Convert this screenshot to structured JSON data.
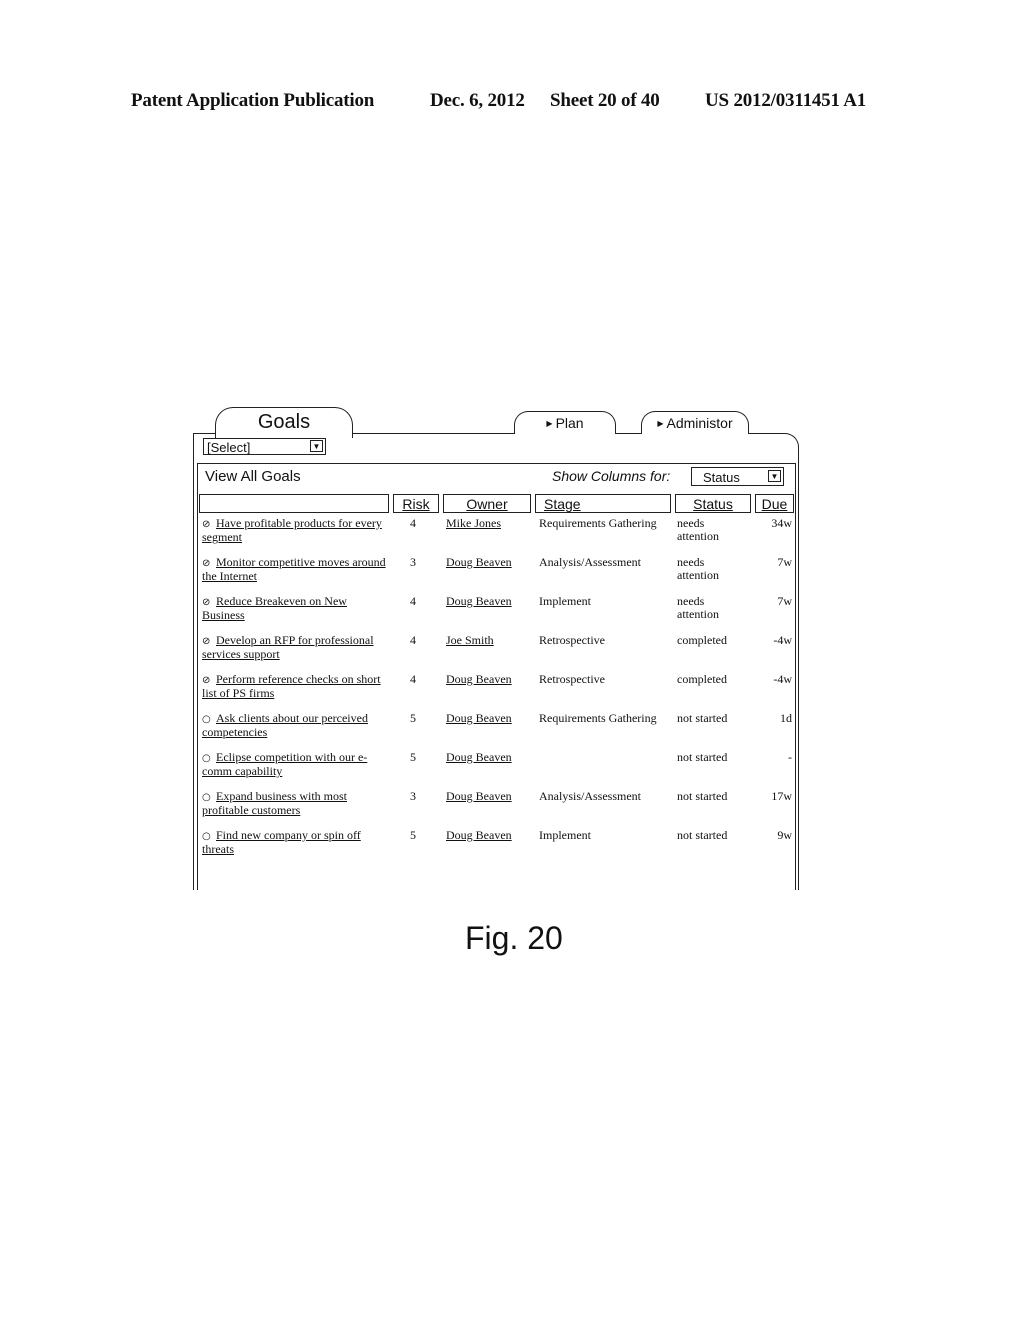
{
  "header": {
    "publication": "Patent Application Publication",
    "date": "Dec. 6, 2012",
    "sheet": "Sheet 20 of 40",
    "number": "US 2012/0311451 A1"
  },
  "tabs": [
    {
      "label": "Goals",
      "active": true
    },
    {
      "label": "Plan",
      "active": false
    },
    {
      "label": "Administor",
      "active": false
    }
  ],
  "selector": {
    "value": "[Select]"
  },
  "panel": {
    "title": "View All Goals",
    "show_columns_label": "Show Columns for:",
    "show_columns_value": "Status"
  },
  "columns": [
    "",
    "Risk",
    "Owner",
    "Stage",
    "Status",
    "Due"
  ],
  "rows": [
    {
      "icon": "needs-attention-icon",
      "glyph": "⊘",
      "name": "Have profitable products for every segment",
      "risk": "4",
      "owner": "Mike Jones",
      "stage": "Requirements Gathering",
      "status": "needs attention",
      "due": "34w"
    },
    {
      "icon": "needs-attention-icon",
      "glyph": "⊘",
      "name": "Monitor competitive moves around the Internet",
      "risk": "3",
      "owner": "Doug Beaven",
      "stage": "Analysis/Assessment",
      "status": "needs attention",
      "due": "7w"
    },
    {
      "icon": "needs-attention-icon",
      "glyph": "⊘",
      "name": "Reduce Breakeven on New Business",
      "risk": "4",
      "owner": "Doug Beaven",
      "stage": "Implement",
      "status": "needs attention",
      "due": "7w"
    },
    {
      "icon": "completed-icon",
      "glyph": "⊘",
      "name": "Develop an RFP for professional services support",
      "risk": "4",
      "owner": "Joe Smith",
      "stage": "Retrospective",
      "status": "completed",
      "due": "-4w"
    },
    {
      "icon": "completed-icon",
      "glyph": "⊘",
      "name": "Perform reference checks on short list of PS firms",
      "risk": "4",
      "owner": "Doug Beaven",
      "stage": "Retrospective",
      "status": "completed",
      "due": "-4w"
    },
    {
      "icon": "not-started-icon",
      "glyph": "○",
      "name": "Ask clients about our perceived competencies",
      "risk": "5",
      "owner": "Doug Beaven",
      "stage": "Requirements Gathering",
      "status": "not started",
      "due": "1d"
    },
    {
      "icon": "not-started-icon",
      "glyph": "○",
      "name": "Eclipse competition with our e-comm capability",
      "risk": "5",
      "owner": "Doug Beaven",
      "stage": "",
      "status": "not started",
      "due": "-"
    },
    {
      "icon": "not-started-icon",
      "glyph": "○",
      "name": "Expand business with most profitable customers",
      "risk": "3",
      "owner": "Doug Beaven",
      "stage": "Analysis/Assessment",
      "status": "not started",
      "due": "17w"
    },
    {
      "icon": "not-started-icon",
      "glyph": "○",
      "name": "Find new company or spin off threats",
      "risk": "5",
      "owner": "Doug Beaven",
      "stage": "Implement",
      "status": "not started",
      "due": "9w"
    }
  ],
  "caption": "Fig. 20"
}
